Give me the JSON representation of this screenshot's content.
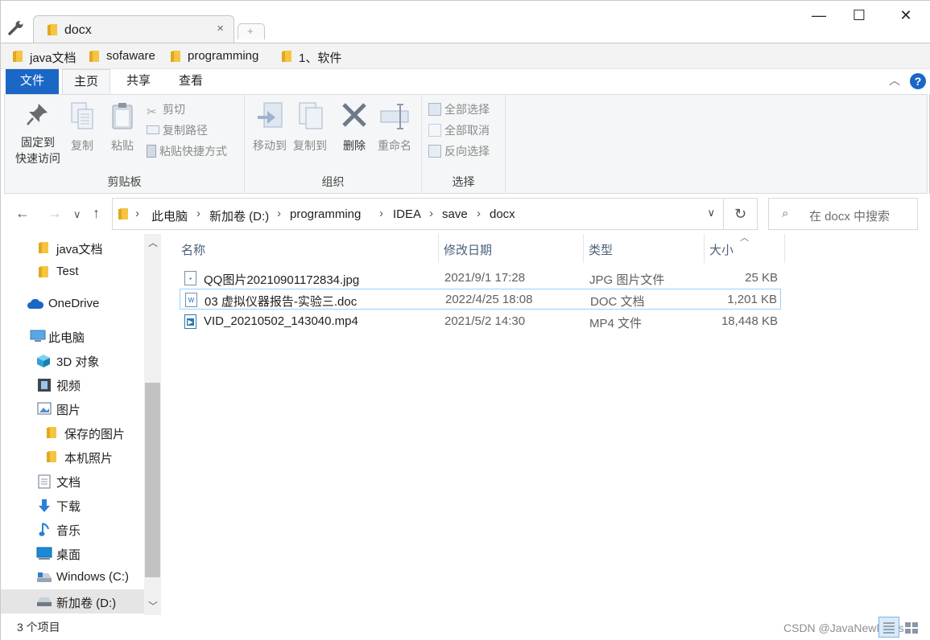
{
  "window": {
    "tab_title": "docx",
    "tab_close": "×",
    "new_tab": "+",
    "minimize": "—",
    "maximize": "☐",
    "close": "✕"
  },
  "bookmarks": [
    {
      "label": "java文档"
    },
    {
      "label": "sofaware"
    },
    {
      "label": "programming"
    },
    {
      "label": "1、软件"
    }
  ],
  "ribbon_tabs": {
    "file": "文件",
    "home": "主页",
    "share": "共享",
    "view": "查看",
    "help": "?"
  },
  "ribbon": {
    "clipboard": {
      "label": "剪贴板",
      "pin_line1": "固定到",
      "pin_line2": "快速访问",
      "copy": "复制",
      "paste": "粘贴",
      "cut": "剪切",
      "copy_path": "复制路径",
      "paste_shortcut": "粘贴快捷方式"
    },
    "organize": {
      "label": "组织",
      "move_to": "移动到",
      "copy_to": "复制到",
      "delete": "删除",
      "rename": "重命名"
    },
    "select": {
      "label": "选择",
      "select_all": "全部选择",
      "select_none": "全部取消",
      "invert": "反向选择"
    }
  },
  "address": {
    "crumbs": [
      "此电脑",
      "新加卷 (D:)",
      "programming",
      "IDEA",
      "save",
      "docx"
    ],
    "search_placeholder": "在 docx 中搜索"
  },
  "sidebar": {
    "items": [
      {
        "label": "java文档",
        "icon": "folder-icon"
      },
      {
        "label": "Test",
        "icon": "folder-icon"
      },
      {
        "label": "OneDrive",
        "icon": "cloud-icon"
      },
      {
        "label": "此电脑",
        "icon": "computer-icon"
      },
      {
        "label": "3D 对象",
        "icon": "cube-icon"
      },
      {
        "label": "视频",
        "icon": "video-icon"
      },
      {
        "label": "图片",
        "icon": "picture-icon"
      },
      {
        "label": "保存的图片",
        "icon": "folder-icon"
      },
      {
        "label": "本机照片",
        "icon": "folder-icon"
      },
      {
        "label": "文档",
        "icon": "document-icon"
      },
      {
        "label": "下载",
        "icon": "download-icon"
      },
      {
        "label": "音乐",
        "icon": "music-icon"
      },
      {
        "label": "桌面",
        "icon": "desktop-icon"
      },
      {
        "label": "Windows (C:)",
        "icon": "drive-icon"
      },
      {
        "label": "新加卷 (D:)",
        "icon": "drive-icon"
      }
    ]
  },
  "list": {
    "columns": {
      "name": "名称",
      "date": "修改日期",
      "type": "类型",
      "size": "大小"
    },
    "rows": [
      {
        "name": "QQ图片20210901172834.jpg",
        "date": "2021/9/1 17:28",
        "type": "JPG 图片文件",
        "size": "25 KB",
        "icon": "image-file-icon"
      },
      {
        "name": "03 虚拟仪器报告-实验三.doc",
        "date": "2022/4/25 18:08",
        "type": "DOC 文档",
        "size": "1,201 KB",
        "icon": "word-file-icon"
      },
      {
        "name": "VID_20210502_143040.mp4",
        "date": "2021/5/2 14:30",
        "type": "MP4 文件",
        "size": "18,448 KB",
        "icon": "video-file-icon"
      }
    ]
  },
  "status": {
    "count": "3 个项目",
    "watermark": "CSDN @JavaNewMans"
  },
  "colors": {
    "accent": "#1a67c6",
    "folder": "#f5c542",
    "selection_border": "#99d1ff"
  }
}
